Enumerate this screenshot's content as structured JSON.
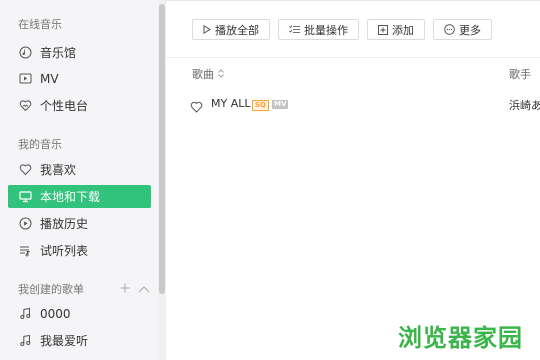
{
  "sidebar": {
    "sections": {
      "online": "在线音乐",
      "mine": "我的音乐",
      "created": "我创建的歌单"
    },
    "online_items": [
      {
        "label": "音乐馆",
        "icon": "music-hall-icon"
      },
      {
        "label": "MV",
        "icon": "mv-icon"
      },
      {
        "label": "个性电台",
        "icon": "radio-icon"
      }
    ],
    "mine_items": [
      {
        "label": "我喜欢",
        "icon": "heart-icon"
      },
      {
        "label": "本地和下载",
        "icon": "monitor-icon",
        "active": true
      },
      {
        "label": "播放历史",
        "icon": "history-icon"
      },
      {
        "label": "试听列表",
        "icon": "playlist-icon"
      }
    ],
    "created_items": [
      {
        "label": "0000",
        "icon": "music-note-icon"
      },
      {
        "label": "我最爱听",
        "icon": "music-note-icon"
      }
    ]
  },
  "toolbar": {
    "play_all": "播放全部",
    "batch": "批量操作",
    "add": "添加",
    "more": "更多"
  },
  "table": {
    "headers": {
      "song": "歌曲",
      "artist": "歌手"
    },
    "rows": [
      {
        "title": "MY ALL",
        "badges": [
          "SQ",
          "MV"
        ],
        "artist": "浜崎あ"
      }
    ]
  },
  "watermark": "浏览器家园",
  "colors": {
    "accent": "#31c27c",
    "sq": "#ff9f28",
    "watermark": "#3ab54a"
  }
}
